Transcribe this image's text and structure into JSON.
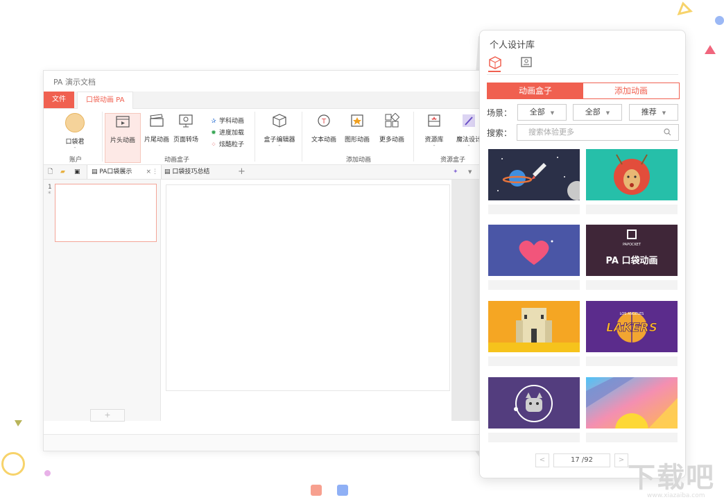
{
  "window": {
    "title": "PA 演示文档"
  },
  "ribbon_tabs": [
    {
      "label": "文件"
    },
    {
      "label": "口袋动画 PA"
    }
  ],
  "ribbon": {
    "account_label": "口袋君",
    "account_group": "账户",
    "btn_intro": "片头动画",
    "btn_outro": "片尾动画",
    "btn_transition": "页面转场",
    "small_subject": "学科动画",
    "small_progress": "进度加载",
    "small_particles": "炫酷粒子",
    "group_anim_box": "动画盒子",
    "btn_box_editor": "盒子编辑器",
    "btn_text_anim": "文本动画",
    "btn_shape_anim": "图形动画",
    "btn_more_anim": "更多动画",
    "group_add_anim": "添加动画",
    "btn_library": "资源库",
    "btn_magic": "魔法设计",
    "group_resource": "资源盒子",
    "dash": "-"
  },
  "doc_tabs": [
    {
      "label": "PA口袋展示"
    },
    {
      "label": "口袋技巧总结"
    }
  ],
  "slides": {
    "number": "1",
    "marker": "*"
  },
  "panel": {
    "title": "个人设计库",
    "seg_active": "动画盒子",
    "seg_inactive": "添加动画",
    "scene_label": "场景：",
    "dd1": "全部",
    "dd2": "全部",
    "dd3": "推荐",
    "search_label": "搜索：",
    "search_placeholder": "搜索体验更多",
    "pager_text": "17 /92",
    "prev": "<",
    "next": ">"
  },
  "cards": {
    "lakers_text": "LAKERS",
    "lakers_sub": "LOS ANGELES",
    "papocket_brand": "PAPOCKET",
    "papocket_title": "PA 口袋动画"
  },
  "watermark": {
    "text": "下载吧",
    "url": "www.xiazaiba.com"
  },
  "colors": {
    "accent": "#f06050"
  }
}
